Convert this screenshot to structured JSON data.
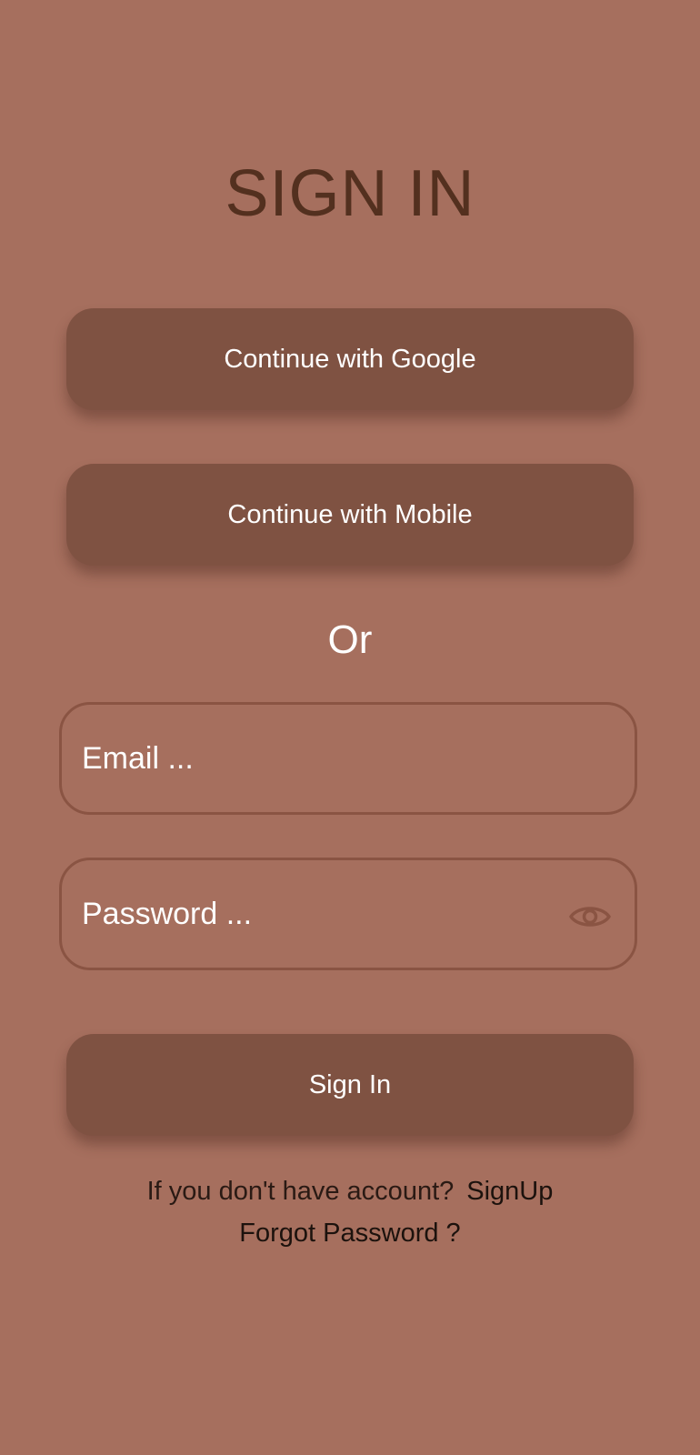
{
  "page": {
    "title": "SIGN IN",
    "background_color": "#a66f5e",
    "button_color": "#7f5242"
  },
  "social": {
    "google_label": "Continue with Google",
    "mobile_label": "Continue with Mobile"
  },
  "divider": {
    "text": "Or"
  },
  "form": {
    "email_placeholder": "Email ...",
    "email_value": "",
    "password_placeholder": "Password ...",
    "password_value": "",
    "password_toggle_icon": "eye-icon",
    "submit_label": "Sign In"
  },
  "footer": {
    "signup_prompt": "If you don't have account?",
    "signup_link": "SignUp",
    "forgot_link": "Forgot Password ?"
  }
}
